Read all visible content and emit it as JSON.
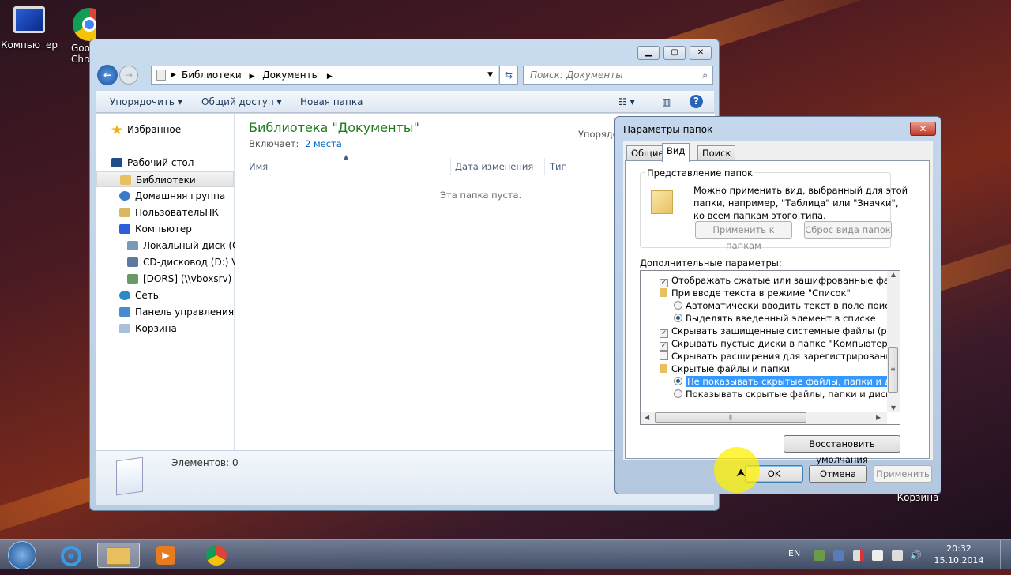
{
  "desktop": {
    "icons": [
      {
        "label": "Компьютер",
        "icon": "computer-icon"
      },
      {
        "label": "Google Chrome",
        "icon": "chrome-icon"
      },
      {
        "label": "Корзина",
        "icon": "recycle-bin-icon"
      }
    ]
  },
  "explorer": {
    "breadcrumb": [
      "Библиотеки",
      "Документы"
    ],
    "search_placeholder": "Поиск: Документы",
    "toolbar": {
      "organize": "Упорядочить",
      "share": "Общий доступ",
      "new_folder": "Новая папка"
    },
    "nav": {
      "favorites": "Избранное",
      "items": [
        {
          "label": "Рабочий стол",
          "level": 0
        },
        {
          "label": "Библиотеки",
          "level": 1,
          "selected": true
        },
        {
          "label": "Домашняя группа",
          "level": 1
        },
        {
          "label": "ПользовательПК",
          "level": 1
        },
        {
          "label": "Компьютер",
          "level": 1
        },
        {
          "label": "Локальный диск (C:)",
          "level": 2
        },
        {
          "label": "CD-дисковод (D:) Virt",
          "level": 2
        },
        {
          "label": "[DORS] (\\\\vboxsrv) (E",
          "level": 2
        },
        {
          "label": "Сеть",
          "level": 1
        },
        {
          "label": "Панель управления",
          "level": 1
        },
        {
          "label": "Корзина",
          "level": 1
        }
      ]
    },
    "library_title": "Библиотека \"Документы\"",
    "includes_label": "Включает:",
    "includes_link": "2 места",
    "arrange_label": "Упорядо",
    "columns": [
      "Имя",
      "Дата изменения",
      "Тип"
    ],
    "empty_text": "Эта папка пуста.",
    "status": "Элементов: 0"
  },
  "dialog": {
    "title": "Параметры папок",
    "tabs": [
      "Общие",
      "Вид",
      "Поиск"
    ],
    "active_tab": "Вид",
    "group_title": "Представление папок",
    "group_text": [
      "Можно применить вид, выбранный для этой",
      "папки, например, \"Таблица\" или \"Значки\",",
      "ко всем папкам этого типа."
    ],
    "apply_to_folders": "Применить к папкам",
    "reset_folders": "Сброс вида папок",
    "advanced_label": "Дополнительные параметры:",
    "options": [
      {
        "type": "checkbox",
        "checked": true,
        "label": "Отображать сжатые или зашифрованные файлы NTI"
      },
      {
        "type": "folder",
        "label": "При вводе текста в режиме \"Список\""
      },
      {
        "type": "radio",
        "checked": false,
        "label": "Автоматически вводить текст в поле поиска"
      },
      {
        "type": "radio",
        "checked": true,
        "label": "Выделять введенный элемент в списке"
      },
      {
        "type": "checkbox",
        "checked": true,
        "label": "Скрывать защищенные системные файлы (рекомен,"
      },
      {
        "type": "checkbox",
        "checked": true,
        "label": "Скрывать пустые диски в папке \"Компьютер\""
      },
      {
        "type": "checkbox",
        "checked": false,
        "label": "Скрывать расширения для зарегистрированных типс"
      },
      {
        "type": "folder",
        "label": "Скрытые файлы и папки"
      },
      {
        "type": "radio",
        "checked": true,
        "selected": true,
        "label": "Не показывать скрытые файлы, папки и диски"
      },
      {
        "type": "radio",
        "checked": false,
        "label": "Показывать скрытые файлы, папки и диски"
      }
    ],
    "restore_defaults": "Восстановить умолчания",
    "ok": "OK",
    "cancel": "Отмена",
    "apply": "Применить"
  },
  "taskbar": {
    "lang": "EN",
    "time": "20:32",
    "date": "15.10.2014"
  },
  "colors": {
    "accent_green": "#1e7a1e",
    "link": "#0066cc",
    "selection": "#3399ff"
  }
}
